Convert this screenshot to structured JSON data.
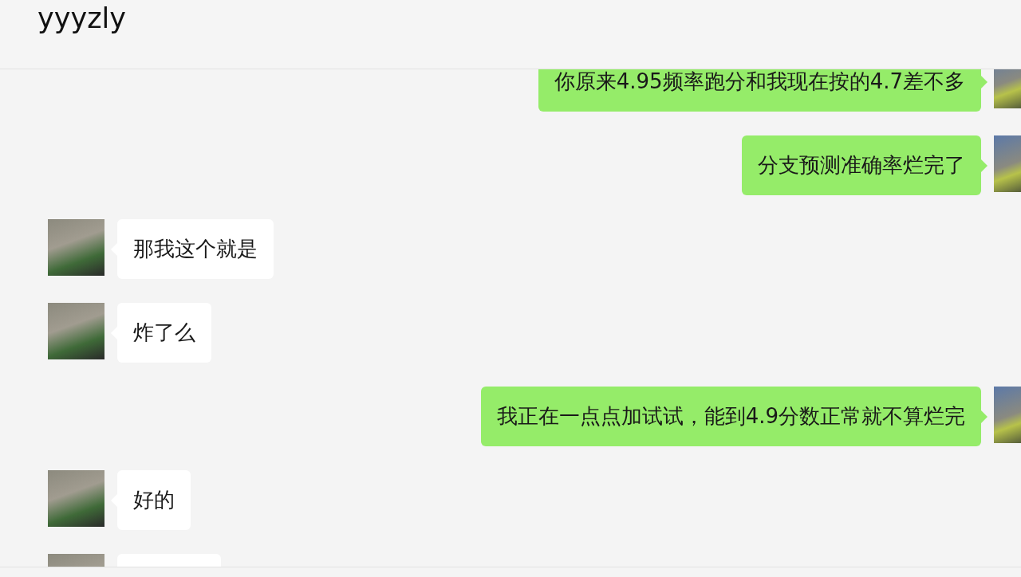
{
  "window": {
    "title": "yyyzly"
  },
  "messages": [
    {
      "kind": "sent",
      "text": "你原来4.95频率跑分和我现在按的4.7差不多"
    },
    {
      "kind": "sent",
      "text": "分支预测准确率烂完了"
    },
    {
      "kind": "received",
      "text": "那我这个就是"
    },
    {
      "kind": "received",
      "text": "炸了么"
    },
    {
      "kind": "sent",
      "text": "我正在一点点加试试，能到4.9分数正常就不算烂完"
    },
    {
      "kind": "received",
      "text": "好的"
    },
    {
      "kind": "received"
    }
  ]
}
